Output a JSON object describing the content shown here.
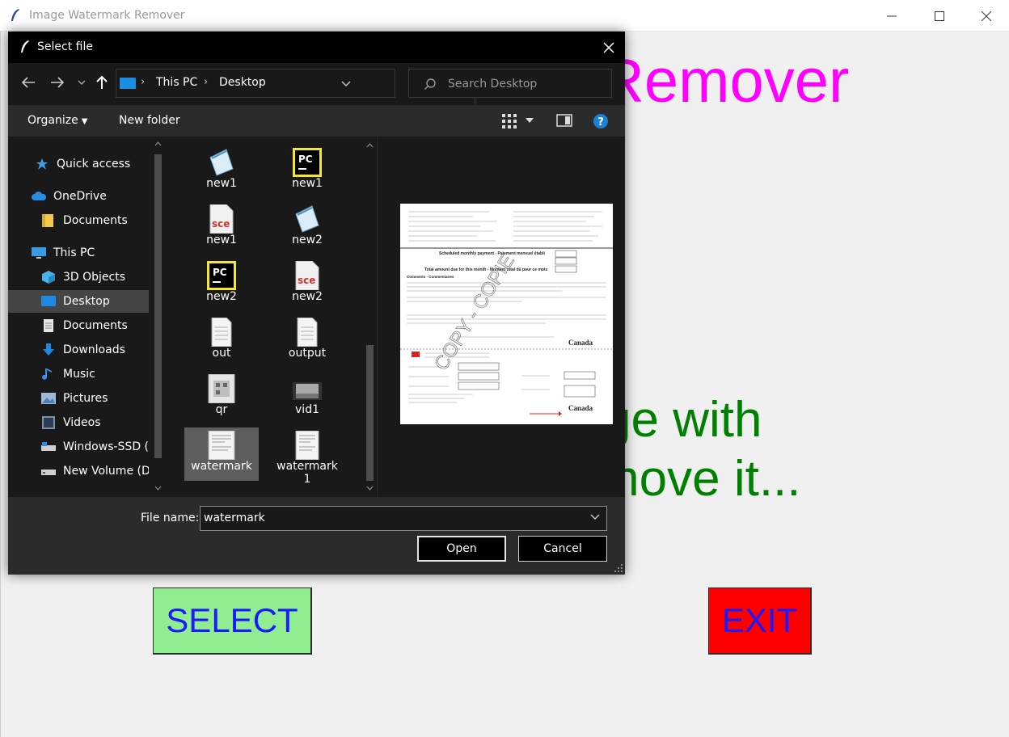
{
  "app": {
    "title": "Image Watermark Remover",
    "heading": "Image Watermark Remover",
    "heading_visible": "Remover",
    "instruction_line1": "ge with",
    "instruction_line2": "move it...",
    "select_label": "SELECT",
    "exit_label": "EXIT",
    "colors": {
      "heading": "#ff00ff",
      "instruction": "#008000",
      "select_bg": "#90ee90",
      "exit_bg": "#ff0000",
      "button_text": "#1a1aff"
    }
  },
  "dialog": {
    "title": "Select file",
    "breadcrumb": [
      "This PC",
      "Desktop"
    ],
    "search_placeholder": "Search Desktop",
    "toolbar": {
      "organize": "Organize",
      "new_folder": "New folder"
    },
    "nav_items": [
      {
        "label": "Quick access",
        "icon": "star-icon"
      },
      {
        "label": "OneDrive",
        "icon": "cloud-icon"
      },
      {
        "label": "Documents",
        "icon": "folder-icon"
      },
      {
        "label": "This PC",
        "icon": "computer-icon"
      },
      {
        "label": "3D Objects",
        "icon": "cube-icon"
      },
      {
        "label": "Desktop",
        "icon": "desktop-icon",
        "selected": true
      },
      {
        "label": "Documents",
        "icon": "document-folder-icon"
      },
      {
        "label": "Downloads",
        "icon": "download-icon"
      },
      {
        "label": "Music",
        "icon": "music-icon"
      },
      {
        "label": "Pictures",
        "icon": "pictures-icon"
      },
      {
        "label": "Videos",
        "icon": "videos-icon"
      },
      {
        "label": "Windows-SSD (C",
        "icon": "drive-icon"
      },
      {
        "label": "New Volume (D:",
        "icon": "drive-icon"
      }
    ],
    "files": [
      {
        "label": "new1",
        "icon": "notepad-icon"
      },
      {
        "label": "new1",
        "icon": "pycharm-icon"
      },
      {
        "label": "new1",
        "icon": "sce-file-icon"
      },
      {
        "label": "new2",
        "icon": "notepad-icon"
      },
      {
        "label": "new2",
        "icon": "pycharm-icon"
      },
      {
        "label": "new2",
        "icon": "sce-file-icon"
      },
      {
        "label": "out",
        "icon": "text-file-icon"
      },
      {
        "label": "output",
        "icon": "text-file-icon"
      },
      {
        "label": "qr",
        "icon": "image-thumbnail-icon"
      },
      {
        "label": "vid1",
        "icon": "video-thumbnail-icon"
      },
      {
        "label": "watermark",
        "icon": "image-thumbnail-icon",
        "selected": true
      },
      {
        "label": "watermark\n1",
        "icon": "image-thumbnail-icon"
      }
    ],
    "file_name_label": "File name:",
    "file_name_value": "watermark",
    "open_label": "Open",
    "cancel_label": "Cancel",
    "preview": {
      "heading": "Scheduled monthly payment - Paiement mensuel établi",
      "total_line": "Total amount due for this month - Montant total dû pour ce mois",
      "comments": "Comments - Commentaires",
      "watermark_text": "COPY - COPIE",
      "brand": "Canada"
    }
  }
}
